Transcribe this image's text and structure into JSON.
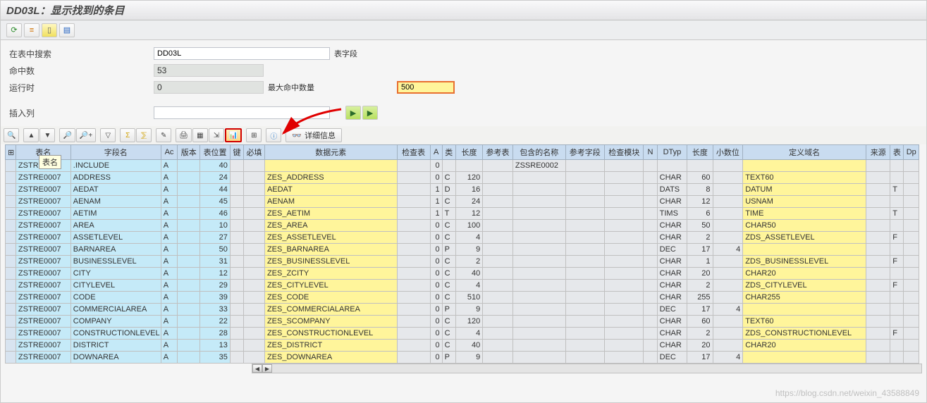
{
  "title": "DD03L：显示找到的条目",
  "form": {
    "search_label": "在表中搜索",
    "search_value": "DD03L",
    "field_label": "表字段",
    "hits_label": "命中数",
    "hits_value": "53",
    "runtime_label": "运行时",
    "runtime_value": "0",
    "max_hits_label": "最大命中数量",
    "max_hits_value": "500",
    "insert_label": "插入列",
    "insert_value": ""
  },
  "tooltip": "表名",
  "details_btn": "详细信息",
  "columns": [
    "",
    "表名",
    "字段名",
    "Ac",
    "版本",
    "表位置",
    "键",
    "必填",
    "数据元素",
    "检查表",
    "A",
    "类",
    "长度",
    "参考表",
    "包含的名称",
    "参考字段",
    "检查模块",
    "N",
    "DTyp",
    "长度",
    "小数位",
    "定义域名",
    "来源",
    "表",
    "Dp"
  ],
  "rows": [
    {
      "tab": "ZSTRE0007",
      "fld": ".INCLUDE",
      "ac": "A",
      "ver": "",
      "pos": "40",
      "key": "",
      "req": "",
      "elem": "",
      "chk": "",
      "a": "0",
      "ty": "",
      "len": "",
      "rt": "",
      "inc": "ZSSRE0002",
      "rf": "",
      "cm": "",
      "n": "",
      "dt": "",
      "ln": "",
      "dec": "",
      "dom": "",
      "src": "",
      "t": "",
      "dp": ""
    },
    {
      "tab": "ZSTRE0007",
      "fld": "ADDRESS",
      "ac": "A",
      "ver": "",
      "pos": "24",
      "key": "",
      "req": "",
      "elem": "ZES_ADDRESS",
      "chk": "",
      "a": "0",
      "ty": "C",
      "len": "120",
      "rt": "",
      "inc": "",
      "rf": "",
      "cm": "",
      "n": "",
      "dt": "CHAR",
      "ln": "60",
      "dec": "",
      "dom": "TEXT60",
      "src": "",
      "t": "",
      "dp": ""
    },
    {
      "tab": "ZSTRE0007",
      "fld": "AEDAT",
      "ac": "A",
      "ver": "",
      "pos": "44",
      "key": "",
      "req": "",
      "elem": "AEDAT",
      "chk": "",
      "a": "1",
      "ty": "D",
      "len": "16",
      "rt": "",
      "inc": "",
      "rf": "",
      "cm": "",
      "n": "",
      "dt": "DATS",
      "ln": "8",
      "dec": "",
      "dom": "DATUM",
      "src": "",
      "t": "T",
      "dp": ""
    },
    {
      "tab": "ZSTRE0007",
      "fld": "AENAM",
      "ac": "A",
      "ver": "",
      "pos": "45",
      "key": "",
      "req": "",
      "elem": "AENAM",
      "chk": "",
      "a": "1",
      "ty": "C",
      "len": "24",
      "rt": "",
      "inc": "",
      "rf": "",
      "cm": "",
      "n": "",
      "dt": "CHAR",
      "ln": "12",
      "dec": "",
      "dom": "USNAM",
      "src": "",
      "t": "",
      "dp": ""
    },
    {
      "tab": "ZSTRE0007",
      "fld": "AETIM",
      "ac": "A",
      "ver": "",
      "pos": "46",
      "key": "",
      "req": "",
      "elem": "ZES_AETIM",
      "chk": "",
      "a": "1",
      "ty": "T",
      "len": "12",
      "rt": "",
      "inc": "",
      "rf": "",
      "cm": "",
      "n": "",
      "dt": "TIMS",
      "ln": "6",
      "dec": "",
      "dom": "TIME",
      "src": "",
      "t": "T",
      "dp": ""
    },
    {
      "tab": "ZSTRE0007",
      "fld": "AREA",
      "ac": "A",
      "ver": "",
      "pos": "10",
      "key": "",
      "req": "",
      "elem": "ZES_AREA",
      "chk": "",
      "a": "0",
      "ty": "C",
      "len": "100",
      "rt": "",
      "inc": "",
      "rf": "",
      "cm": "",
      "n": "",
      "dt": "CHAR",
      "ln": "50",
      "dec": "",
      "dom": "CHAR50",
      "src": "",
      "t": "",
      "dp": ""
    },
    {
      "tab": "ZSTRE0007",
      "fld": "ASSETLEVEL",
      "ac": "A",
      "ver": "",
      "pos": "27",
      "key": "",
      "req": "",
      "elem": "ZES_ASSETLEVEL",
      "chk": "",
      "a": "0",
      "ty": "C",
      "len": "4",
      "rt": "",
      "inc": "",
      "rf": "",
      "cm": "",
      "n": "",
      "dt": "CHAR",
      "ln": "2",
      "dec": "",
      "dom": "ZDS_ASSETLEVEL",
      "src": "",
      "t": "F",
      "dp": ""
    },
    {
      "tab": "ZSTRE0007",
      "fld": "BARNAREA",
      "ac": "A",
      "ver": "",
      "pos": "50",
      "key": "",
      "req": "",
      "elem": "ZES_BARNAREA",
      "chk": "",
      "a": "0",
      "ty": "P",
      "len": "9",
      "rt": "",
      "inc": "",
      "rf": "",
      "cm": "",
      "n": "",
      "dt": "DEC",
      "ln": "17",
      "dec": "4",
      "dom": "",
      "src": "",
      "t": "",
      "dp": ""
    },
    {
      "tab": "ZSTRE0007",
      "fld": "BUSINESSLEVEL",
      "ac": "A",
      "ver": "",
      "pos": "31",
      "key": "",
      "req": "",
      "elem": "ZES_BUSINESSLEVEL",
      "chk": "",
      "a": "0",
      "ty": "C",
      "len": "2",
      "rt": "",
      "inc": "",
      "rf": "",
      "cm": "",
      "n": "",
      "dt": "CHAR",
      "ln": "1",
      "dec": "",
      "dom": "ZDS_BUSINESSLEVEL",
      "src": "",
      "t": "F",
      "dp": ""
    },
    {
      "tab": "ZSTRE0007",
      "fld": "CITY",
      "ac": "A",
      "ver": "",
      "pos": "12",
      "key": "",
      "req": "",
      "elem": "ZES_ZCITY",
      "chk": "",
      "a": "0",
      "ty": "C",
      "len": "40",
      "rt": "",
      "inc": "",
      "rf": "",
      "cm": "",
      "n": "",
      "dt": "CHAR",
      "ln": "20",
      "dec": "",
      "dom": "CHAR20",
      "src": "",
      "t": "",
      "dp": ""
    },
    {
      "tab": "ZSTRE0007",
      "fld": "CITYLEVEL",
      "ac": "A",
      "ver": "",
      "pos": "29",
      "key": "",
      "req": "",
      "elem": "ZES_CITYLEVEL",
      "chk": "",
      "a": "0",
      "ty": "C",
      "len": "4",
      "rt": "",
      "inc": "",
      "rf": "",
      "cm": "",
      "n": "",
      "dt": "CHAR",
      "ln": "2",
      "dec": "",
      "dom": "ZDS_CITYLEVEL",
      "src": "",
      "t": "F",
      "dp": ""
    },
    {
      "tab": "ZSTRE0007",
      "fld": "CODE",
      "ac": "A",
      "ver": "",
      "pos": "39",
      "key": "",
      "req": "",
      "elem": "ZES_CODE",
      "chk": "",
      "a": "0",
      "ty": "C",
      "len": "510",
      "rt": "",
      "inc": "",
      "rf": "",
      "cm": "",
      "n": "",
      "dt": "CHAR",
      "ln": "255",
      "dec": "",
      "dom": "CHAR255",
      "src": "",
      "t": "",
      "dp": ""
    },
    {
      "tab": "ZSTRE0007",
      "fld": "COMMERCIALAREA",
      "ac": "A",
      "ver": "",
      "pos": "33",
      "key": "",
      "req": "",
      "elem": "ZES_COMMERCIALAREA",
      "chk": "",
      "a": "0",
      "ty": "P",
      "len": "9",
      "rt": "",
      "inc": "",
      "rf": "",
      "cm": "",
      "n": "",
      "dt": "DEC",
      "ln": "17",
      "dec": "4",
      "dom": "",
      "src": "",
      "t": "",
      "dp": ""
    },
    {
      "tab": "ZSTRE0007",
      "fld": "COMPANY",
      "ac": "A",
      "ver": "",
      "pos": "22",
      "key": "",
      "req": "",
      "elem": "ZES_SCOMPANY",
      "chk": "",
      "a": "0",
      "ty": "C",
      "len": "120",
      "rt": "",
      "inc": "",
      "rf": "",
      "cm": "",
      "n": "",
      "dt": "CHAR",
      "ln": "60",
      "dec": "",
      "dom": "TEXT60",
      "src": "",
      "t": "",
      "dp": ""
    },
    {
      "tab": "ZSTRE0007",
      "fld": "CONSTRUCTIONLEVEL",
      "ac": "A",
      "ver": "",
      "pos": "28",
      "key": "",
      "req": "",
      "elem": "ZES_CONSTRUCTIONLEVEL",
      "chk": "",
      "a": "0",
      "ty": "C",
      "len": "4",
      "rt": "",
      "inc": "",
      "rf": "",
      "cm": "",
      "n": "",
      "dt": "CHAR",
      "ln": "2",
      "dec": "",
      "dom": "ZDS_CONSTRUCTIONLEVEL",
      "src": "",
      "t": "F",
      "dp": ""
    },
    {
      "tab": "ZSTRE0007",
      "fld": "DISTRICT",
      "ac": "A",
      "ver": "",
      "pos": "13",
      "key": "",
      "req": "",
      "elem": "ZES_DISTRICT",
      "chk": "",
      "a": "0",
      "ty": "C",
      "len": "40",
      "rt": "",
      "inc": "",
      "rf": "",
      "cm": "",
      "n": "",
      "dt": "CHAR",
      "ln": "20",
      "dec": "",
      "dom": "CHAR20",
      "src": "",
      "t": "",
      "dp": ""
    },
    {
      "tab": "ZSTRE0007",
      "fld": "DOWNAREA",
      "ac": "A",
      "ver": "",
      "pos": "35",
      "key": "",
      "req": "",
      "elem": "ZES_DOWNAREA",
      "chk": "",
      "a": "0",
      "ty": "P",
      "len": "9",
      "rt": "",
      "inc": "",
      "rf": "",
      "cm": "",
      "n": "",
      "dt": "DEC",
      "ln": "17",
      "dec": "4",
      "dom": "",
      "src": "",
      "t": "",
      "dp": ""
    }
  ]
}
